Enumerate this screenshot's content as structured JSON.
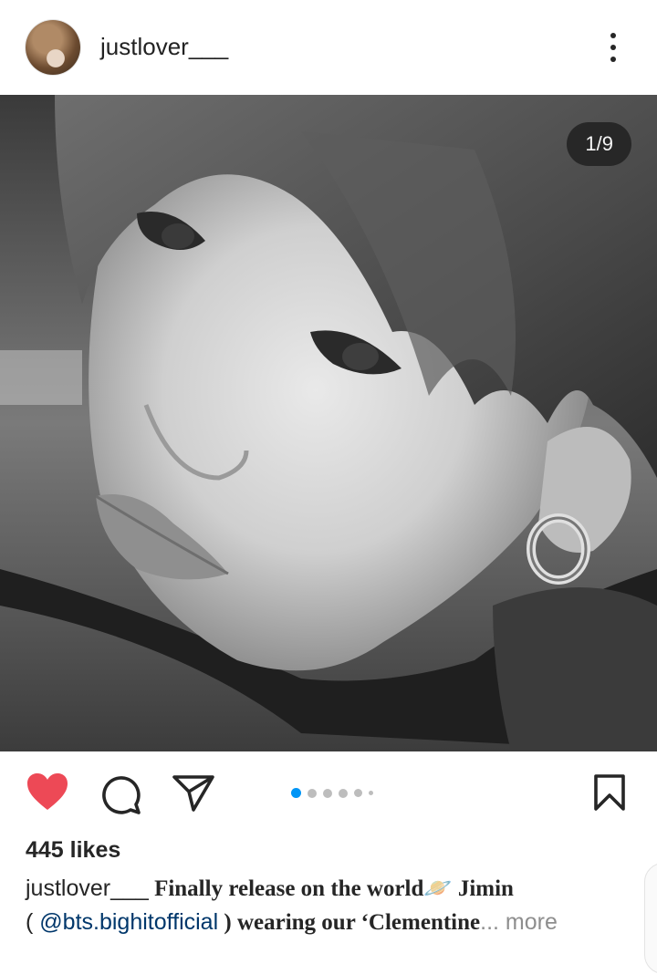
{
  "post": {
    "username": "justlover___",
    "slide_counter": "1/9",
    "likes": "445 likes",
    "caption": {
      "username": "justlover___",
      "text_line1": " Finally release on the world",
      "emoji": "🪐",
      "text_line1b": "  Jimin",
      "open_paren": "( ",
      "mention": "@bts.bighitofficial",
      "text_line2": " ) wearing our ‘Clementine",
      "ellipsis": "...",
      "more": " more"
    }
  },
  "icons": {
    "header_more": "more-vertical-icon",
    "like": "heart-icon",
    "comment": "comment-icon",
    "share": "share-icon",
    "save": "bookmark-icon"
  },
  "carousel": {
    "total_dots_visible": 6,
    "active_index": 0
  },
  "colors": {
    "like_red": "#ed4956",
    "active_dot": "#0095f6",
    "inactive_dot": "#bdbdbd",
    "mention_blue": "#00376b",
    "more_gray": "#8e8e8e"
  }
}
